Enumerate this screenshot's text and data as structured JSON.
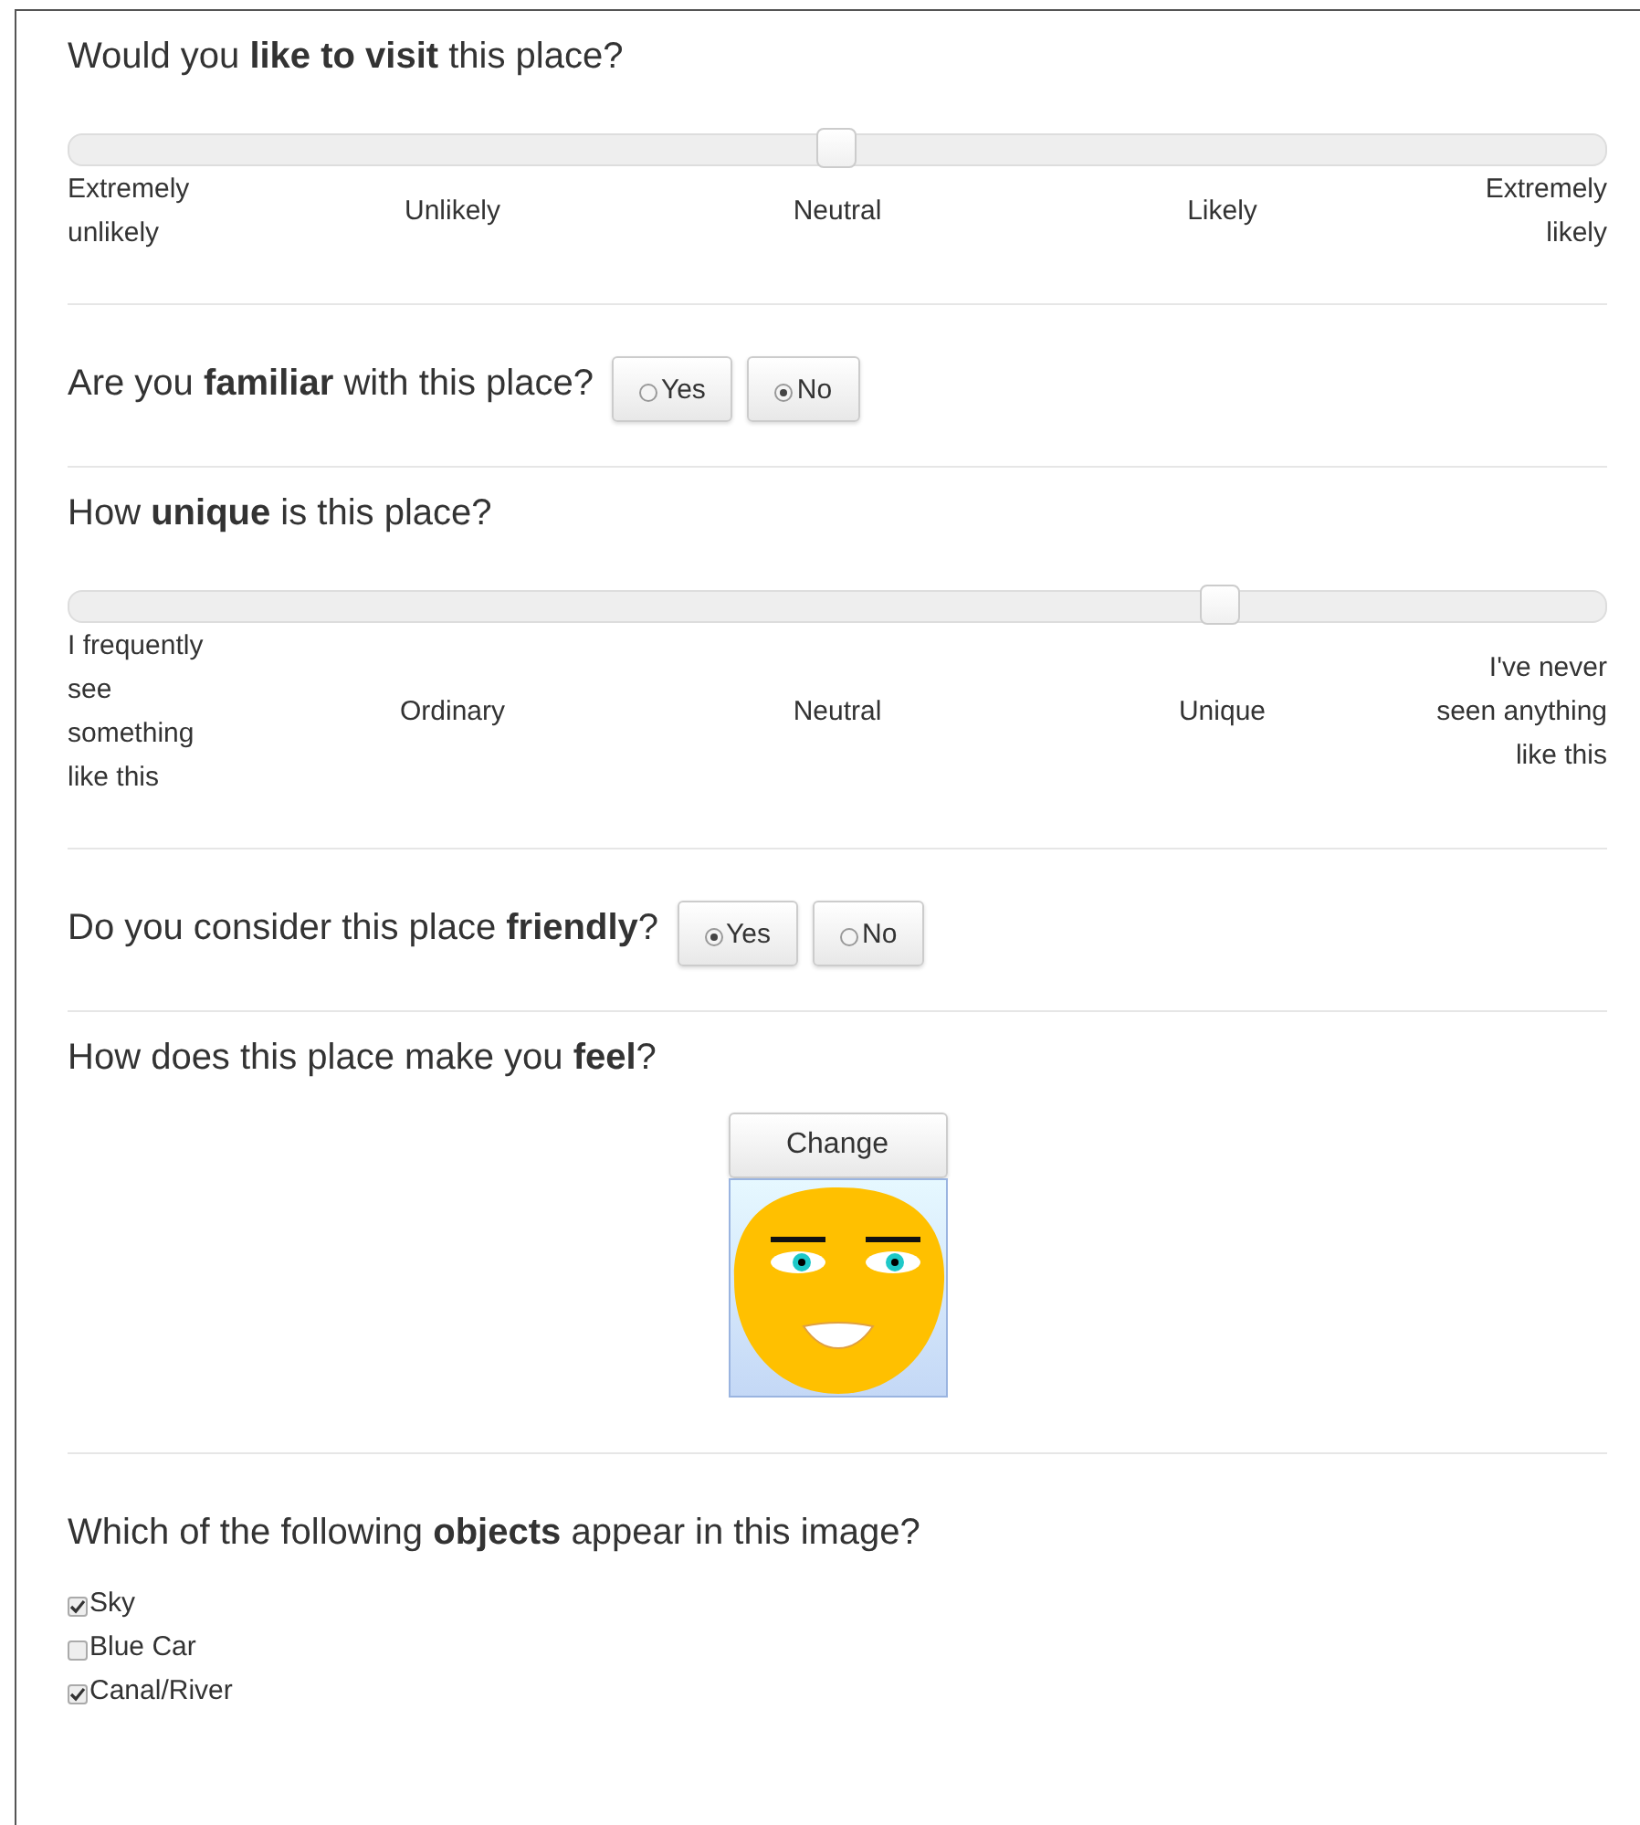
{
  "questions": [
    {
      "kind": "slider",
      "text": "Would you **like to visit** this place?",
      "level": 0.5,
      "labels": [
        "Extremely unlikely",
        "Unlikely",
        "Neutral",
        "Likely",
        "Extremely likely"
      ]
    },
    {
      "kind": "choice",
      "text": "Are you **familiar** with this place?",
      "options": [
        {
          "label": "Yes",
          "selected": false
        },
        {
          "label": "No",
          "selected": true
        }
      ]
    },
    {
      "kind": "slider",
      "text": "How **unique** is this place?",
      "level": 0.75,
      "labels": [
        "I frequently see something like this",
        "Ordinary",
        "Neutral",
        "Unique",
        "I've never seen anything like this"
      ]
    },
    {
      "kind": "choice",
      "text": "Do you consider this place **friendly**?",
      "options": [
        {
          "label": "Yes",
          "selected": true
        },
        {
          "label": "No",
          "selected": false
        }
      ]
    },
    {
      "kind": "face",
      "text": "How does this place make you **feel**?",
      "button": "Change"
    },
    {
      "kind": "checklist",
      "text": "Which of the following **objects** appear in this image?",
      "items": [
        {
          "label": "Sky",
          "checked": true
        },
        {
          "label": "Blue Car",
          "checked": false
        },
        {
          "label": "Canal/River",
          "checked": true
        }
      ]
    }
  ]
}
